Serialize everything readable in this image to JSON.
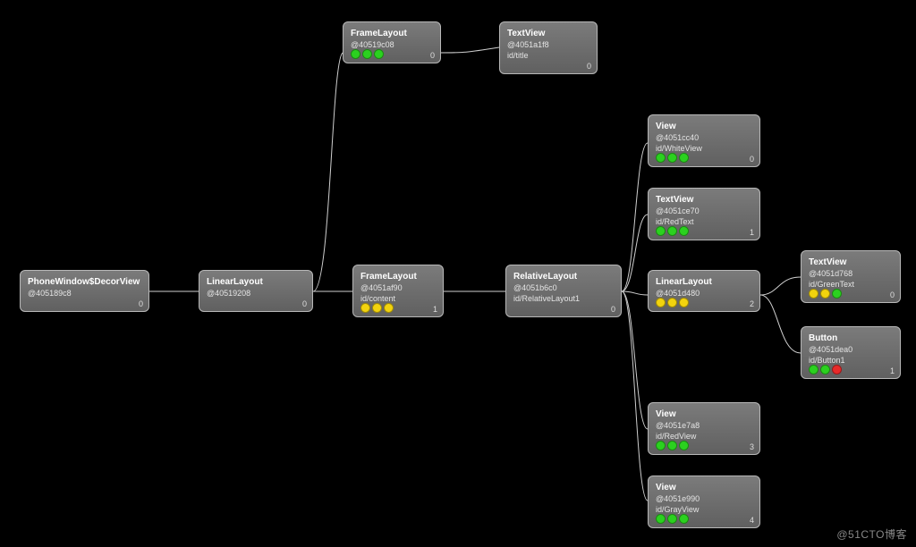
{
  "watermark": "@51CTO博客",
  "nodes": {
    "n0": {
      "title": "PhoneWindow$DecorView",
      "hash": "@405189c8",
      "viewId": "",
      "index": "0",
      "dots": []
    },
    "n1": {
      "title": "LinearLayout",
      "hash": "@40519208",
      "viewId": "",
      "index": "0",
      "dots": []
    },
    "n2": {
      "title": "FrameLayout",
      "hash": "@40519c08",
      "viewId": "",
      "index": "0",
      "dots": [
        "g",
        "g",
        "g"
      ]
    },
    "n3": {
      "title": "TextView",
      "hash": "@4051a1f8",
      "viewId": "id/title",
      "index": "0",
      "dots": []
    },
    "n4": {
      "title": "FrameLayout",
      "hash": "@4051af90",
      "viewId": "id/content",
      "index": "1",
      "dots": [
        "y",
        "y",
        "y"
      ]
    },
    "n5": {
      "title": "RelativeLayout",
      "hash": "@4051b6c0",
      "viewId": "id/RelativeLayout1",
      "index": "0",
      "dots": []
    },
    "n6": {
      "title": "View",
      "hash": "@4051cc40",
      "viewId": "id/WhiteView",
      "index": "0",
      "dots": [
        "g",
        "g",
        "g"
      ]
    },
    "n7": {
      "title": "TextView",
      "hash": "@4051ce70",
      "viewId": "id/RedText",
      "index": "1",
      "dots": [
        "g",
        "g",
        "g"
      ]
    },
    "n8": {
      "title": "LinearLayout",
      "hash": "@4051d480",
      "viewId": "",
      "index": "2",
      "dots": [
        "y",
        "y",
        "y"
      ]
    },
    "n9": {
      "title": "TextView",
      "hash": "@4051d768",
      "viewId": "id/GreenText",
      "index": "0",
      "dots": [
        "y",
        "y",
        "g"
      ]
    },
    "n10": {
      "title": "Button",
      "hash": "@4051dea0",
      "viewId": "id/Button1",
      "index": "1",
      "dots": [
        "g",
        "g",
        "r"
      ]
    },
    "n11": {
      "title": "View",
      "hash": "@4051e7a8",
      "viewId": "id/RedView",
      "index": "3",
      "dots": [
        "g",
        "g",
        "g"
      ]
    },
    "n12": {
      "title": "View",
      "hash": "@4051e990",
      "viewId": "id/GrayView",
      "index": "4",
      "dots": [
        "g",
        "g",
        "g"
      ]
    }
  },
  "chart_data": {
    "type": "tree",
    "root": "PhoneWindow$DecorView @405189c8",
    "edges": [
      [
        "PhoneWindow$DecorView",
        "LinearLayout@40519208"
      ],
      [
        "LinearLayout@40519208",
        "FrameLayout@40519c08"
      ],
      [
        "LinearLayout@40519208",
        "FrameLayout@4051af90"
      ],
      [
        "FrameLayout@40519c08",
        "TextView id/title"
      ],
      [
        "FrameLayout@4051af90",
        "RelativeLayout id/RelativeLayout1"
      ],
      [
        "RelativeLayout",
        "View id/WhiteView"
      ],
      [
        "RelativeLayout",
        "TextView id/RedText"
      ],
      [
        "RelativeLayout",
        "LinearLayout@4051d480"
      ],
      [
        "RelativeLayout",
        "View id/RedView"
      ],
      [
        "RelativeLayout",
        "View id/GrayView"
      ],
      [
        "LinearLayout@4051d480",
        "TextView id/GreenText"
      ],
      [
        "LinearLayout@4051d480",
        "Button id/Button1"
      ]
    ]
  }
}
